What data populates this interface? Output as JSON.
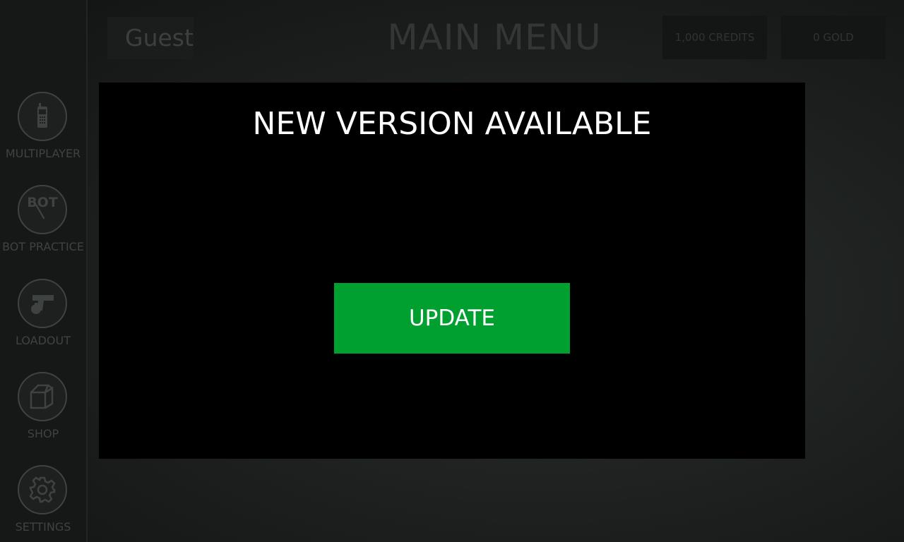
{
  "header": {
    "player_name": "Guest",
    "title": "MAIN MENU",
    "credits": "1,000 CREDITS",
    "gold": "0 GOLD"
  },
  "sidebar": {
    "items": [
      {
        "label": "MULTIPLAYER",
        "icon": "walkie-talkie-icon"
      },
      {
        "label": "BOT PRACTICE",
        "icon": "bot-knife-icon",
        "badge": "BOT"
      },
      {
        "label": "LOADOUT",
        "icon": "pistol-grenade-icon"
      },
      {
        "label": "SHOP",
        "icon": "crate-icon"
      },
      {
        "label": "SETTINGS",
        "icon": "gear-icon"
      }
    ]
  },
  "modal": {
    "title": "NEW VERSION AVAILABLE",
    "button_label": "UPDATE"
  },
  "colors": {
    "update_button": "#00a030",
    "modal_background": "#000000",
    "dim_text": "#3e4341"
  }
}
